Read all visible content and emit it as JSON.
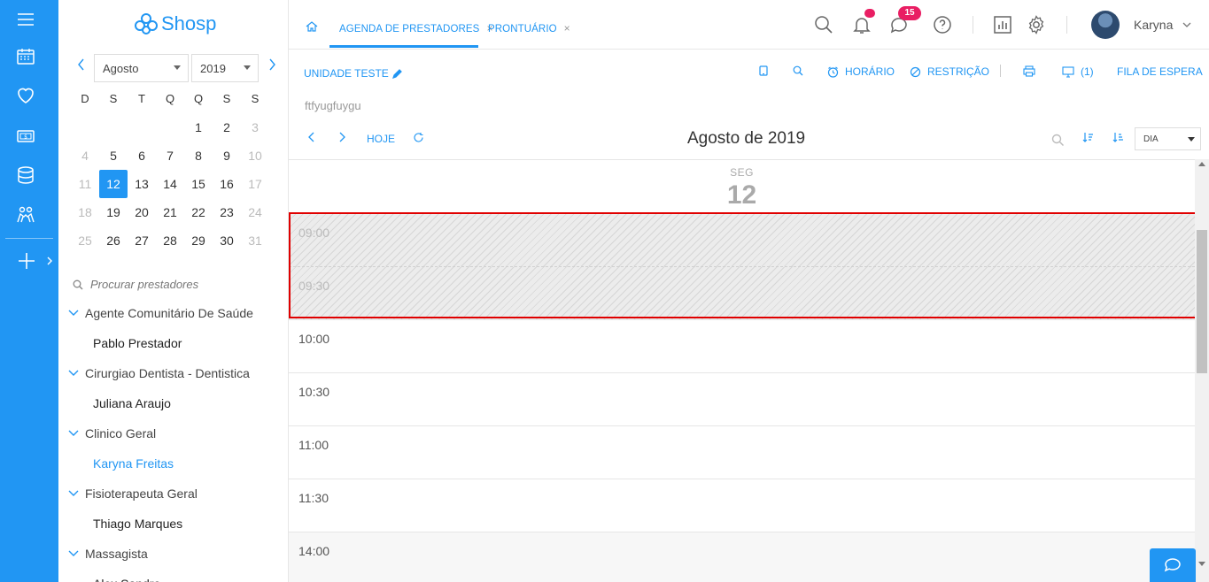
{
  "app": {
    "logo_text": "Shosp"
  },
  "calendar": {
    "month": "Agosto",
    "year": "2019",
    "weekdays": [
      "D",
      "S",
      "T",
      "Q",
      "Q",
      "S",
      "S"
    ],
    "weeks": [
      [
        "",
        "",
        "",
        "",
        "1",
        "2",
        "3"
      ],
      [
        "4",
        "5",
        "6",
        "7",
        "8",
        "9",
        "10"
      ],
      [
        "11",
        "12",
        "13",
        "14",
        "15",
        "16",
        "17"
      ],
      [
        "18",
        "19",
        "20",
        "21",
        "22",
        "23",
        "24"
      ],
      [
        "25",
        "26",
        "27",
        "28",
        "29",
        "30",
        "31"
      ]
    ],
    "selected_day": "12"
  },
  "sidebar": {
    "search_placeholder": "Procurar prestadores",
    "groups": [
      {
        "label": "Agente Comunitário De Saúde",
        "items": [
          {
            "label": "Pablo Prestador",
            "active": false
          }
        ]
      },
      {
        "label": "Cirurgiao Dentista - Dentistica",
        "items": [
          {
            "label": "Juliana Araujo",
            "active": false
          }
        ]
      },
      {
        "label": "Clinico Geral",
        "items": [
          {
            "label": "Karyna Freitas",
            "active": true
          }
        ]
      },
      {
        "label": "Fisioterapeuta Geral",
        "items": [
          {
            "label": "Thiago Marques",
            "active": false
          }
        ]
      },
      {
        "label": "Massagista",
        "items": [
          {
            "label": "Alex Sandro",
            "active": false
          }
        ]
      }
    ]
  },
  "header": {
    "tabs": [
      {
        "label": "AGENDA DE PRESTADORES",
        "close": "×"
      },
      {
        "label": "PRONTUÁRIO",
        "close": "×"
      }
    ],
    "messages_count": "15",
    "user_name": "Karyna"
  },
  "toolbar": {
    "unit_label": "UNIDADE TESTE",
    "horario": "HORÁRIO",
    "restricao": "RESTRIÇÃO",
    "monitor_count": "(1)",
    "fila": "FILA DE ESPERA",
    "subtitle": "ftfyugfuygu"
  },
  "datenav": {
    "today": "HOJE",
    "title": "Agosto de 2019",
    "view": "DIA"
  },
  "day": {
    "weekday": "SEG",
    "number": "12",
    "slots": [
      {
        "time": "09:00",
        "blocked": true
      },
      {
        "time": "09:30",
        "blocked": true
      },
      {
        "time": "10:00",
        "blocked": false
      },
      {
        "time": "10:30",
        "blocked": false
      },
      {
        "time": "11:00",
        "blocked": false
      },
      {
        "time": "11:30",
        "blocked": false
      },
      {
        "time": "14:00",
        "blocked": false
      }
    ]
  },
  "colors": {
    "primary": "#2196f3",
    "badge": "#e91e63",
    "highlight": "#e00000"
  }
}
